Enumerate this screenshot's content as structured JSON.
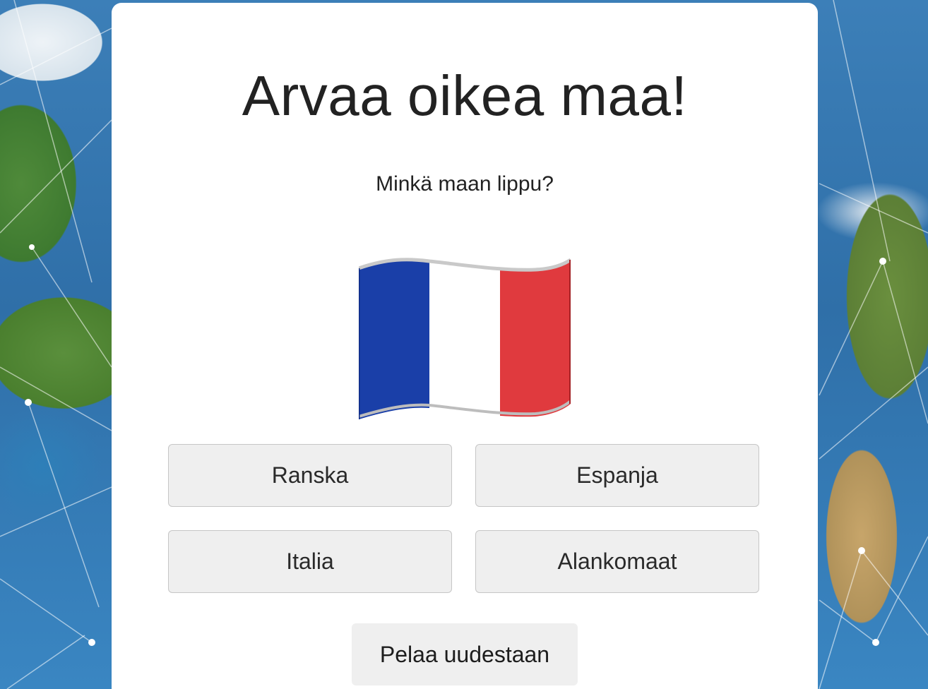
{
  "page": {
    "title": "Arvaa oikea maa!",
    "question": "Minkä maan lippu?"
  },
  "flag": {
    "icon": "flag-of-france-icon",
    "colors": [
      "#1a3fa8",
      "#ffffff",
      "#e03a3e"
    ]
  },
  "answers": [
    {
      "label": "Ranska"
    },
    {
      "label": "Espanja"
    },
    {
      "label": "Italia"
    },
    {
      "label": "Alankomaat"
    }
  ],
  "replay_label": "Pelaa uudestaan",
  "background": {
    "image": "world-map-network-background",
    "accent": "#2f6fa8"
  }
}
